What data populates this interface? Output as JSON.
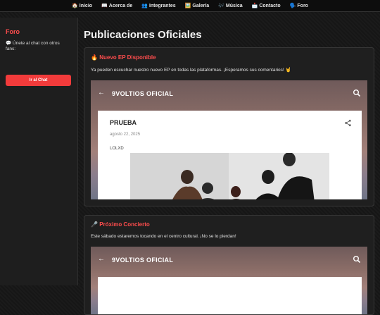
{
  "nav": {
    "items": [
      {
        "icon": "🏠",
        "label": "Inicio"
      },
      {
        "icon": "📖",
        "label": "Acerca de"
      },
      {
        "icon": "👥",
        "label": "Integrantes"
      },
      {
        "icon": "🖼️",
        "label": "Galería"
      },
      {
        "icon": "🎶",
        "label": "Música"
      },
      {
        "icon": "📩",
        "label": "Contacto"
      },
      {
        "icon": "🗣️",
        "label": "Foro"
      }
    ]
  },
  "sidebar": {
    "title": "Foro",
    "text": "💬 Únete al chat con otros fans:",
    "button": "Ir al Chat"
  },
  "main": {
    "title": "Publicaciones Oficiales",
    "posts": [
      {
        "emoji": "🔥",
        "title": "Nuevo EP Disponible",
        "text": "Ya pueden escuchar nuestro nuevo EP en todas las plataformas. ¡Esperamos sus comentarios! 🤘",
        "embed": {
          "blog_name": "9VOLTIOS OFICIAL",
          "post_title": "PRUEBA",
          "date": "agosto 22, 2025",
          "body": "LOLXD"
        }
      },
      {
        "emoji": "🎤",
        "title": "Próximo Concierto",
        "text": "Este sábado estaremos tocando en el centro cultural. ¡No se lo pierdan!",
        "embed": {
          "blog_name": "9VOLTIOS OFICIAL"
        }
      }
    ]
  },
  "colors": {
    "accent": "#ff4d4d",
    "button": "#f23b3b",
    "background": "#161616",
    "card": "#1f1f1f"
  }
}
